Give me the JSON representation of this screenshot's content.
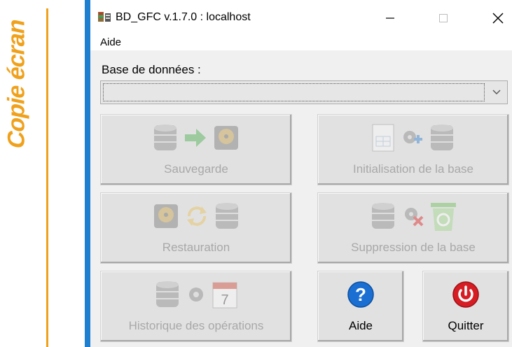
{
  "side_caption": "Copie écran",
  "window": {
    "title": "BD_GFC v.1.7.0 : localhost",
    "menu": [
      "Aide"
    ],
    "database_label": "Base de données :",
    "database_value": ""
  },
  "buttons": [
    {
      "label": "Sauvegarde",
      "enabled": false
    },
    {
      "label": "Initialisation de la base",
      "enabled": false
    },
    {
      "label": "Restauration",
      "enabled": false
    },
    {
      "label": "Suppression de la base",
      "enabled": false
    },
    {
      "label": "Historique des opérations",
      "enabled": false
    },
    {
      "label": "Aide",
      "enabled": true
    },
    {
      "label": "Quitter",
      "enabled": true
    }
  ],
  "colors": {
    "accent_orange": "#f0a11c",
    "window_accent": "#1e7fd0",
    "disabled_text": "#a8a8a8",
    "help_blue": "#1b6fd2",
    "quit_red": "#d71d24"
  },
  "icons": {
    "sauvegarde": [
      "database-icon",
      "arrow-right-icon",
      "hard-disk-icon"
    ],
    "initialisation": [
      "document-icon",
      "gear-plus-icon",
      "database-icon"
    ],
    "restauration": [
      "hard-disk-icon",
      "refresh-icon",
      "database-icon"
    ],
    "suppression": [
      "database-icon",
      "delete-gear-icon",
      "recycle-bin-icon"
    ],
    "historique": [
      "database-icon",
      "gear-icon",
      "calendar-icon"
    ],
    "aide": "help-icon",
    "quitter": "power-icon"
  }
}
